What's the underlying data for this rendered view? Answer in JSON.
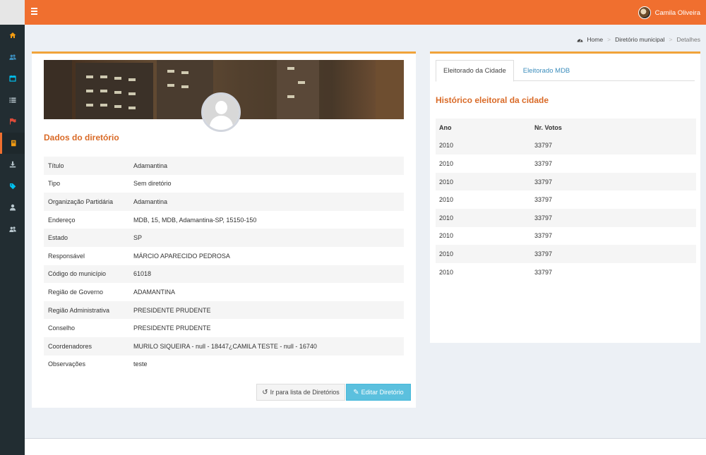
{
  "header": {
    "user_name": "Camila Oliveira",
    "accent_color": "#f06f2f"
  },
  "sidebar": {
    "items": [
      {
        "icon": "home-icon",
        "color": "#f39c12"
      },
      {
        "icon": "users-icon",
        "color": "#3c8dbc"
      },
      {
        "icon": "calendar-icon",
        "color": "#00c0ef"
      },
      {
        "icon": "list-icon",
        "color": "#b8c7ce"
      },
      {
        "icon": "flag-icon",
        "color": "#dd4b39"
      },
      {
        "icon": "book-icon",
        "color": "#f39c12",
        "active": true
      },
      {
        "icon": "download-icon",
        "color": "#b8c7ce"
      },
      {
        "icon": "tag-icon",
        "color": "#00c0ef"
      },
      {
        "icon": "user-icon",
        "color": "#b8c7ce"
      },
      {
        "icon": "group-icon",
        "color": "#b8c7ce"
      }
    ]
  },
  "breadcrumb": {
    "home": "Home",
    "level1": "Diretório municipal",
    "current": "Detalhes"
  },
  "directory": {
    "section_title": "Dados do diretório",
    "fields": [
      {
        "label": "Título",
        "value": "Adamantina"
      },
      {
        "label": "Tipo",
        "value": "Sem diretório"
      },
      {
        "label": "Organização Partidária",
        "value": "Adamantina"
      },
      {
        "label": "Endereço",
        "value": "MDB, 15, MDB, Adamantina-SP, 15150-150"
      },
      {
        "label": "Estado",
        "value": "SP"
      },
      {
        "label": "Responsável",
        "value": "MÁRCIO APARECIDO PEDROSA"
      },
      {
        "label": "Código do município",
        "value": "61018"
      },
      {
        "label": "Região de Governo",
        "value": "ADAMANTINA"
      },
      {
        "label": "Região Administrativa",
        "value": "PRESIDENTE PRUDENTE"
      },
      {
        "label": "Conselho",
        "value": "PRESIDENTE PRUDENTE"
      },
      {
        "label": "Coordenadores",
        "value": "MURILO SIQUEIRA - null - 18447¿CAMILA TESTE - null - 16740"
      },
      {
        "label": "Observações",
        "value": "teste"
      }
    ],
    "back_button": "Ir para lista de Diretórios",
    "edit_button": "Editar Diretório"
  },
  "electorate": {
    "tabs": [
      "Eleitorado da Cidade",
      "Eleitorado MDB"
    ],
    "active_tab": 0,
    "title": "Histórico eleitoral da cidade",
    "columns": [
      "Ano",
      "Nr. Votos"
    ],
    "rows": [
      [
        "2010",
        "33797"
      ],
      [
        "2010",
        "33797"
      ],
      [
        "2010",
        "33797"
      ],
      [
        "2010",
        "33797"
      ],
      [
        "2010",
        "33797"
      ],
      [
        "2010",
        "33797"
      ],
      [
        "2010",
        "33797"
      ],
      [
        "2010",
        "33797"
      ]
    ]
  }
}
